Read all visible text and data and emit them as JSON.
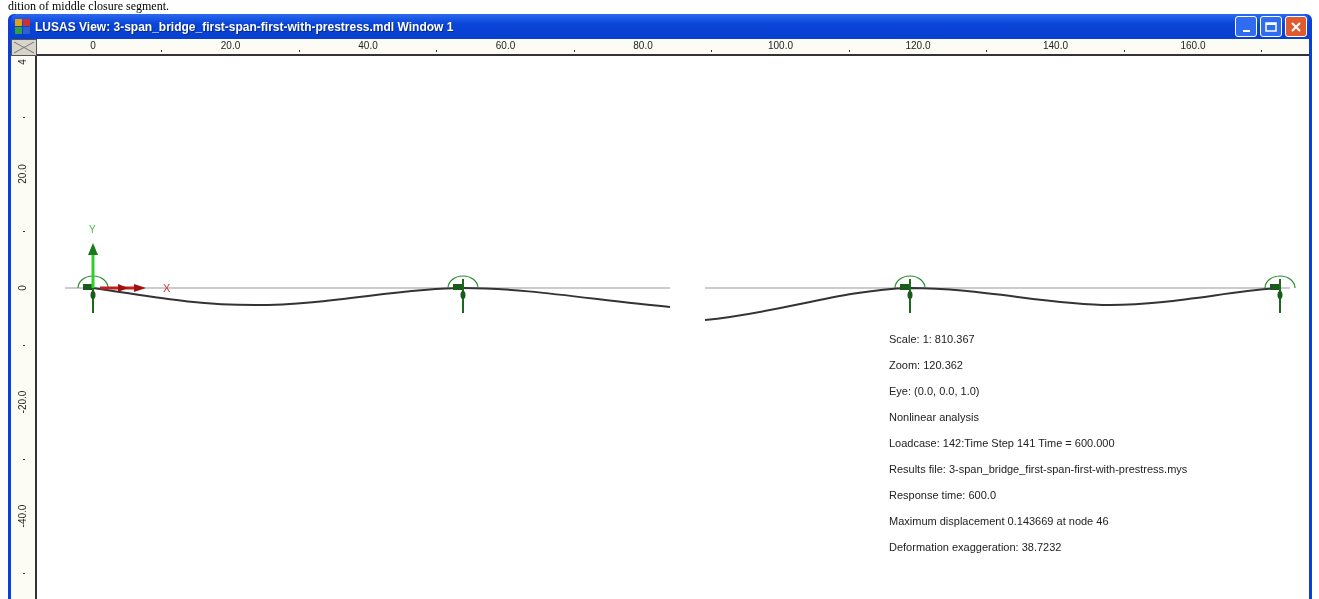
{
  "caption_fragment": "dition of middle closure segment.",
  "window": {
    "title": "LUSAS View: 3-span_bridge_first-span-first-with-prestress.mdl Window 1"
  },
  "ruler_x": {
    "labels": [
      "0",
      "20.0",
      "40.0",
      "60.0",
      "80.0",
      "100.0",
      "120.0",
      "140.0",
      "160.0"
    ]
  },
  "ruler_y": {
    "labels": [
      "4",
      "20.0",
      "0",
      "-20.0",
      "-40.0"
    ]
  },
  "axes": {
    "y_label": "Y",
    "x_label": "X"
  },
  "info_lines": [
    "Scale: 1: 810.367",
    "Zoom: 120.362",
    "Eye: (0.0, 0.0, 1.0)",
    "Nonlinear analysis",
    "Loadcase: 142:Time Step 141 Time = 600.000",
    "Results file: 3-span_bridge_first-span-first-with-prestress.mys",
    "Response time: 600.0",
    "Maximum displacement 0.143669 at node 46",
    "Deformation exaggeration: 38.7232"
  ]
}
